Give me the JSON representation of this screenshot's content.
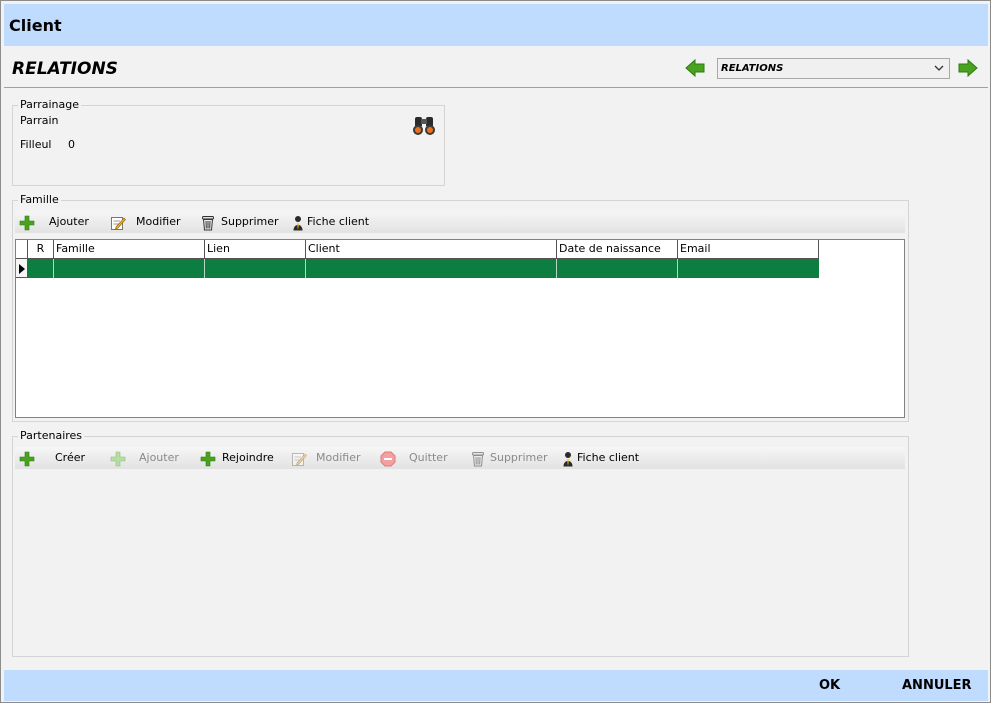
{
  "window": {
    "title": "Client"
  },
  "page": {
    "title": "RELATIONS"
  },
  "nav": {
    "selected": "RELATIONS",
    "prev_icon": "arrow-left-icon",
    "next_icon": "arrow-right-icon",
    "arrow_color": "#4aa31e"
  },
  "parrainage": {
    "legend": "Parrainage",
    "parrain_label": "Parrain",
    "filleul_label": "Filleul",
    "filleul_value": "0",
    "search_icon": "binoculars-icon"
  },
  "famille": {
    "legend": "Famille",
    "toolbar": {
      "add": "Ajouter",
      "edit": "Modifier",
      "delete": "Supprimer",
      "client_card": "Fiche client"
    },
    "columns": [
      "R",
      "Famille",
      "Lien",
      "Client",
      "Date de naissance",
      "Email"
    ],
    "selected_row_color": "#0e7d40"
  },
  "partenaires": {
    "legend": "Partenaires",
    "toolbar": {
      "create": "Créer",
      "add": "Ajouter",
      "join": "Rejoindre",
      "edit": "Modifier",
      "quit": "Quitter",
      "delete": "Supprimer",
      "client_card": "Fiche client"
    }
  },
  "footer": {
    "ok": "OK",
    "cancel": "ANNULER"
  },
  "colors": {
    "title_bar": "#bfdcff",
    "background": "#f2f2f2"
  }
}
